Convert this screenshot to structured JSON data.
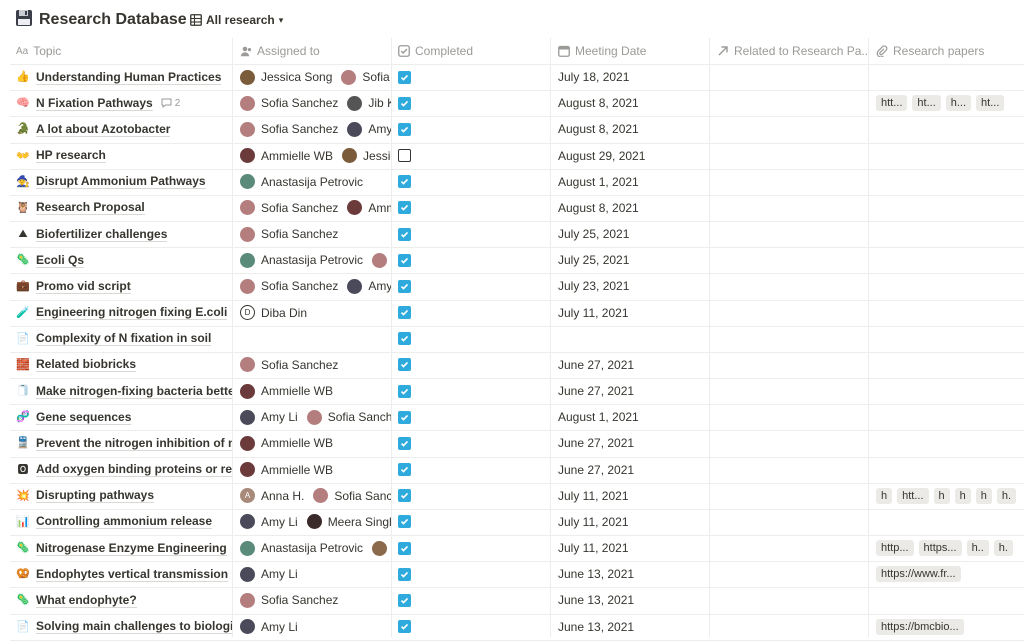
{
  "title": "Research Database",
  "view": {
    "label": "All research"
  },
  "columns": {
    "topic": "Topic",
    "assigned": "Assigned to",
    "completed": "Completed",
    "meeting": "Meeting Date",
    "related": "Related to Research Pa...",
    "papers": "Research papers"
  },
  "colors": {
    "accent_checkbox": "#2eaadc",
    "grid_line": "#ededeb",
    "muted_text": "#9b9a97",
    "chip_bg": "#ebeae7"
  },
  "rows": [
    {
      "emoji": "👍",
      "icon": "thumbs-up-icon",
      "topic": "Understanding Human Practices",
      "people": [
        {
          "name": "Jessica Song",
          "color": "#7a5c3a"
        },
        {
          "name": "Sofia S",
          "color": "#b57e7e"
        }
      ],
      "completed": true,
      "date": "July 18, 2021",
      "papers": []
    },
    {
      "emoji": "🧠",
      "icon": "brain-icon",
      "topic": "N Fixation Pathways",
      "comments": "2",
      "people": [
        {
          "name": "Sofia Sanchez",
          "color": "#b57e7e"
        },
        {
          "name": "Jib K",
          "color": "#555555"
        }
      ],
      "completed": true,
      "date": "August 8, 2021",
      "papers": [
        "htt...",
        "ht...",
        "h...",
        "ht..."
      ]
    },
    {
      "emoji": "🐊",
      "icon": "crocodile-icon",
      "topic": "A lot about Azotobacter",
      "people": [
        {
          "name": "Sofia Sanchez",
          "color": "#b57e7e"
        },
        {
          "name": "Amy L",
          "color": "#4a4a5a"
        }
      ],
      "completed": true,
      "date": "August 8, 2021",
      "papers": []
    },
    {
      "emoji": "👐",
      "icon": "open-hands-icon",
      "topic": "HP research",
      "people": [
        {
          "name": "Ammielle WB",
          "color": "#6b3a3a"
        },
        {
          "name": "Jessica",
          "color": "#7a5c3a"
        }
      ],
      "completed": false,
      "date": "August 29, 2021",
      "papers": []
    },
    {
      "emoji": "🧙",
      "icon": "wizard-icon",
      "topic": "Disrupt Ammonium Pathways",
      "people": [
        {
          "name": "Anastasija Petrovic",
          "color": "#5a8a7a"
        }
      ],
      "completed": true,
      "date": "August 1, 2021",
      "papers": []
    },
    {
      "emoji": "🦉",
      "icon": "owl-icon",
      "topic": "Research Proposal",
      "people": [
        {
          "name": "Sofia Sanchez",
          "color": "#b57e7e"
        },
        {
          "name": "Ammi",
          "color": "#6b3a3a"
        }
      ],
      "completed": true,
      "date": "August 8, 2021",
      "papers": []
    },
    {
      "emoji": "⛰",
      "icon": "mountain-icon",
      "topic": "Biofertilizer challenges",
      "people": [
        {
          "name": "Sofia Sanchez",
          "color": "#b57e7e"
        }
      ],
      "completed": true,
      "date": "July 25, 2021",
      "papers": []
    },
    {
      "emoji": "🦠",
      "icon": "microbe-icon",
      "topic": "Ecoli Qs",
      "people": [
        {
          "name": "Anastasija Petrovic",
          "color": "#5a8a7a"
        },
        {
          "name": "S",
          "color": "#b57e7e"
        }
      ],
      "completed": true,
      "date": "July 25, 2021",
      "papers": []
    },
    {
      "emoji": "💼",
      "icon": "briefcase-icon",
      "topic": "Promo vid script",
      "people": [
        {
          "name": "Sofia Sanchez",
          "color": "#b57e7e"
        },
        {
          "name": "Amy L",
          "color": "#4a4a5a"
        }
      ],
      "completed": true,
      "date": "July 23, 2021",
      "papers": []
    },
    {
      "emoji": "🧪",
      "icon": "test-tube-icon",
      "topic": "Engineering nitrogen fixing E.coli",
      "people": [
        {
          "name": "Diba Din",
          "initial": "D",
          "outline": true
        }
      ],
      "completed": true,
      "date": "July 11, 2021",
      "papers": []
    },
    {
      "emoji": "📄",
      "icon": "page-icon",
      "topic": "Complexity of N fixation in soil",
      "people": [],
      "completed": true,
      "date": "",
      "papers": []
    },
    {
      "emoji": "🧱",
      "icon": "bricks-icon",
      "topic": "Related biobricks",
      "people": [
        {
          "name": "Sofia Sanchez",
          "color": "#b57e7e"
        }
      ],
      "completed": true,
      "date": "June 27, 2021",
      "papers": []
    },
    {
      "emoji": "🧻",
      "icon": "scroll-icon",
      "topic": "Make nitrogen-fixing bacteria better c",
      "people": [
        {
          "name": "Ammielle WB",
          "color": "#6b3a3a"
        }
      ],
      "completed": true,
      "date": "June 27, 2021",
      "papers": []
    },
    {
      "emoji": "🧬",
      "icon": "dna-icon",
      "topic": "Gene sequences",
      "people": [
        {
          "name": "Amy Li",
          "color": "#4a4a5a"
        },
        {
          "name": "Sofia Sanche",
          "color": "#b57e7e"
        }
      ],
      "completed": true,
      "date": "August 1, 2021",
      "papers": []
    },
    {
      "emoji": "🚆",
      "icon": "train-icon",
      "topic": "Prevent the nitrogen inhibition of nitro",
      "people": [
        {
          "name": "Ammielle WB",
          "color": "#6b3a3a"
        }
      ],
      "completed": true,
      "date": "June 27, 2021",
      "papers": []
    },
    {
      "emoji": "🅾",
      "icon": "o-button-icon",
      "topic": "Add oxygen binding proteins or respir",
      "people": [
        {
          "name": "Ammielle WB",
          "color": "#6b3a3a"
        }
      ],
      "completed": true,
      "date": "June 27, 2021",
      "papers": []
    },
    {
      "emoji": "💥",
      "icon": "collision-icon",
      "topic": "Disrupting pathways",
      "people": [
        {
          "name": "Anna H.",
          "initial": "A",
          "color": "#a88a7a"
        },
        {
          "name": "Sofia Sanche",
          "color": "#b57e7e"
        }
      ],
      "completed": true,
      "date": "July 11, 2021",
      "papers": [
        "h",
        "htt...",
        "h",
        "h",
        "h",
        "h."
      ]
    },
    {
      "emoji": "📊",
      "icon": "bar-chart-icon",
      "topic": "Controlling ammonium release",
      "people": [
        {
          "name": "Amy Li",
          "color": "#4a4a5a"
        },
        {
          "name": "Meera Singha",
          "color": "#3a2a2a"
        }
      ],
      "completed": true,
      "date": "July 11, 2021",
      "papers": []
    },
    {
      "emoji": "🦠",
      "icon": "microbe-icon",
      "topic": "Nitrogenase Enzyme Engineering",
      "people": [
        {
          "name": "Anastasija Petrovic",
          "color": "#5a8a7a"
        },
        {
          "name": "V",
          "color": "#8a6a4a"
        }
      ],
      "completed": true,
      "date": "July 11, 2021",
      "papers": [
        "http...",
        "https...",
        "h..",
        "h."
      ]
    },
    {
      "emoji": "🥨",
      "icon": "pretzel-icon",
      "topic": "Endophytes vertical transmission",
      "people": [
        {
          "name": "Amy Li",
          "color": "#4a4a5a"
        }
      ],
      "completed": true,
      "date": "June 13, 2021",
      "papers": [
        "https://www.fr..."
      ]
    },
    {
      "emoji": "🦠",
      "icon": "microbe-icon",
      "topic": "What endophyte?",
      "people": [
        {
          "name": "Sofia Sanchez",
          "color": "#b57e7e"
        }
      ],
      "completed": true,
      "date": "June 13, 2021",
      "papers": []
    },
    {
      "emoji": "📄",
      "icon": "page-icon",
      "topic": "Solving main challenges to biological",
      "people": [
        {
          "name": "Amy Li",
          "color": "#4a4a5a"
        }
      ],
      "completed": true,
      "date": "June 13, 2021",
      "papers": [
        "https://bmcbio..."
      ]
    }
  ]
}
